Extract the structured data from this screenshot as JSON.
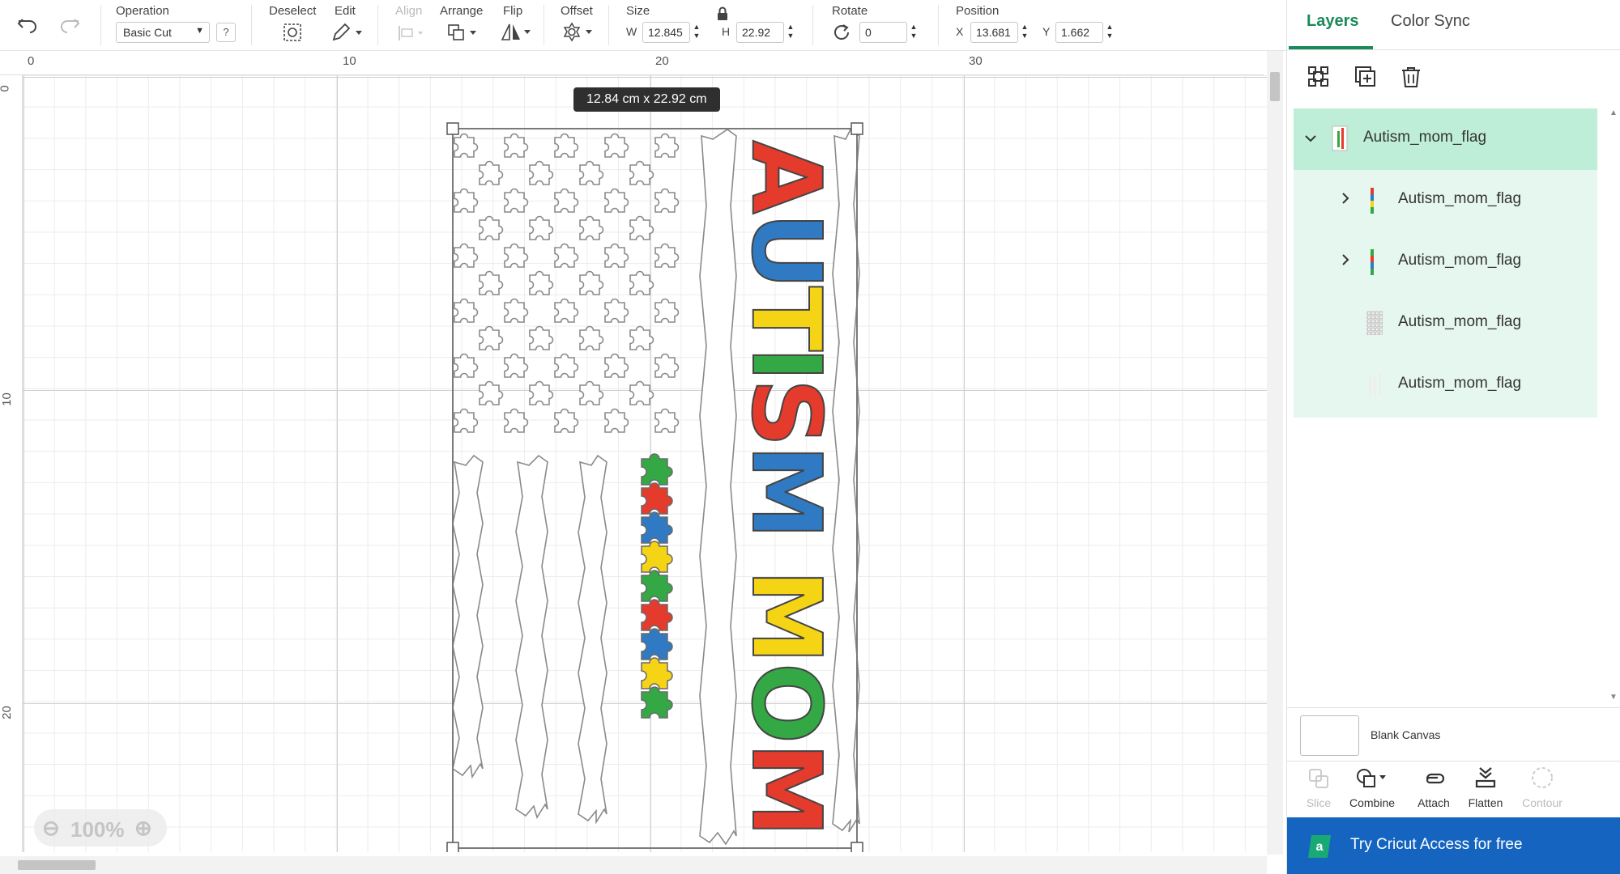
{
  "toolbar": {
    "undo_icon": "undo-icon",
    "redo_icon": "redo-icon",
    "operation": {
      "label": "Operation",
      "value": "Basic Cut",
      "help": "?"
    },
    "deselect": {
      "label": "Deselect"
    },
    "edit": {
      "label": "Edit"
    },
    "align": {
      "label": "Align"
    },
    "arrange": {
      "label": "Arrange"
    },
    "flip": {
      "label": "Flip"
    },
    "offset": {
      "label": "Offset"
    },
    "size": {
      "label": "Size",
      "w_label": "W",
      "w_value": "12.845",
      "h_label": "H",
      "h_value": "22.92"
    },
    "rotate": {
      "label": "Rotate",
      "value": "0"
    },
    "position": {
      "label": "Position",
      "x_label": "X",
      "x_value": "13.681",
      "y_label": "Y",
      "y_value": "1.662"
    }
  },
  "rulers": {
    "top": [
      "0",
      "10",
      "20",
      "30"
    ],
    "left": [
      "0",
      "10",
      "20"
    ]
  },
  "canvas": {
    "size_tooltip": "12.84  cm x 22.92  cm",
    "zoom_level": "100%",
    "design_text": "AUTISM MOM",
    "text_colors": [
      "#e53b2c",
      "#2f7ac2",
      "#f5d415",
      "#33a845",
      "#e53b2c",
      "#2f7ac2",
      "#f5d415",
      "#33a845",
      "#e53b2c",
      "#2f7ac2"
    ],
    "puzzle_colors": [
      "#33a845",
      "#e53b2c",
      "#2f7ac2",
      "#f5d415",
      "#33a845",
      "#e53b2c",
      "#2f7ac2",
      "#f5d415",
      "#33a845"
    ]
  },
  "panel": {
    "tabs": [
      "Layers",
      "Color Sync"
    ],
    "layers": [
      {
        "name": "Autism_mom_flag",
        "expanded": true
      },
      {
        "name": "Autism_mom_flag"
      },
      {
        "name": "Autism_mom_flag"
      },
      {
        "name": "Autism_mom_flag"
      },
      {
        "name": "Autism_mom_flag"
      }
    ],
    "blank_canvas": "Blank Canvas",
    "bottom_tools": [
      "Slice",
      "Combine",
      "Attach",
      "Flatten",
      "Contour"
    ],
    "promo": "Try Cricut Access for free"
  },
  "colors": {
    "accent": "#1a8a5a",
    "selected_layer": "#bfeed8",
    "layer_group": "#e6f7f0",
    "promo_bg": "#1565c0"
  }
}
